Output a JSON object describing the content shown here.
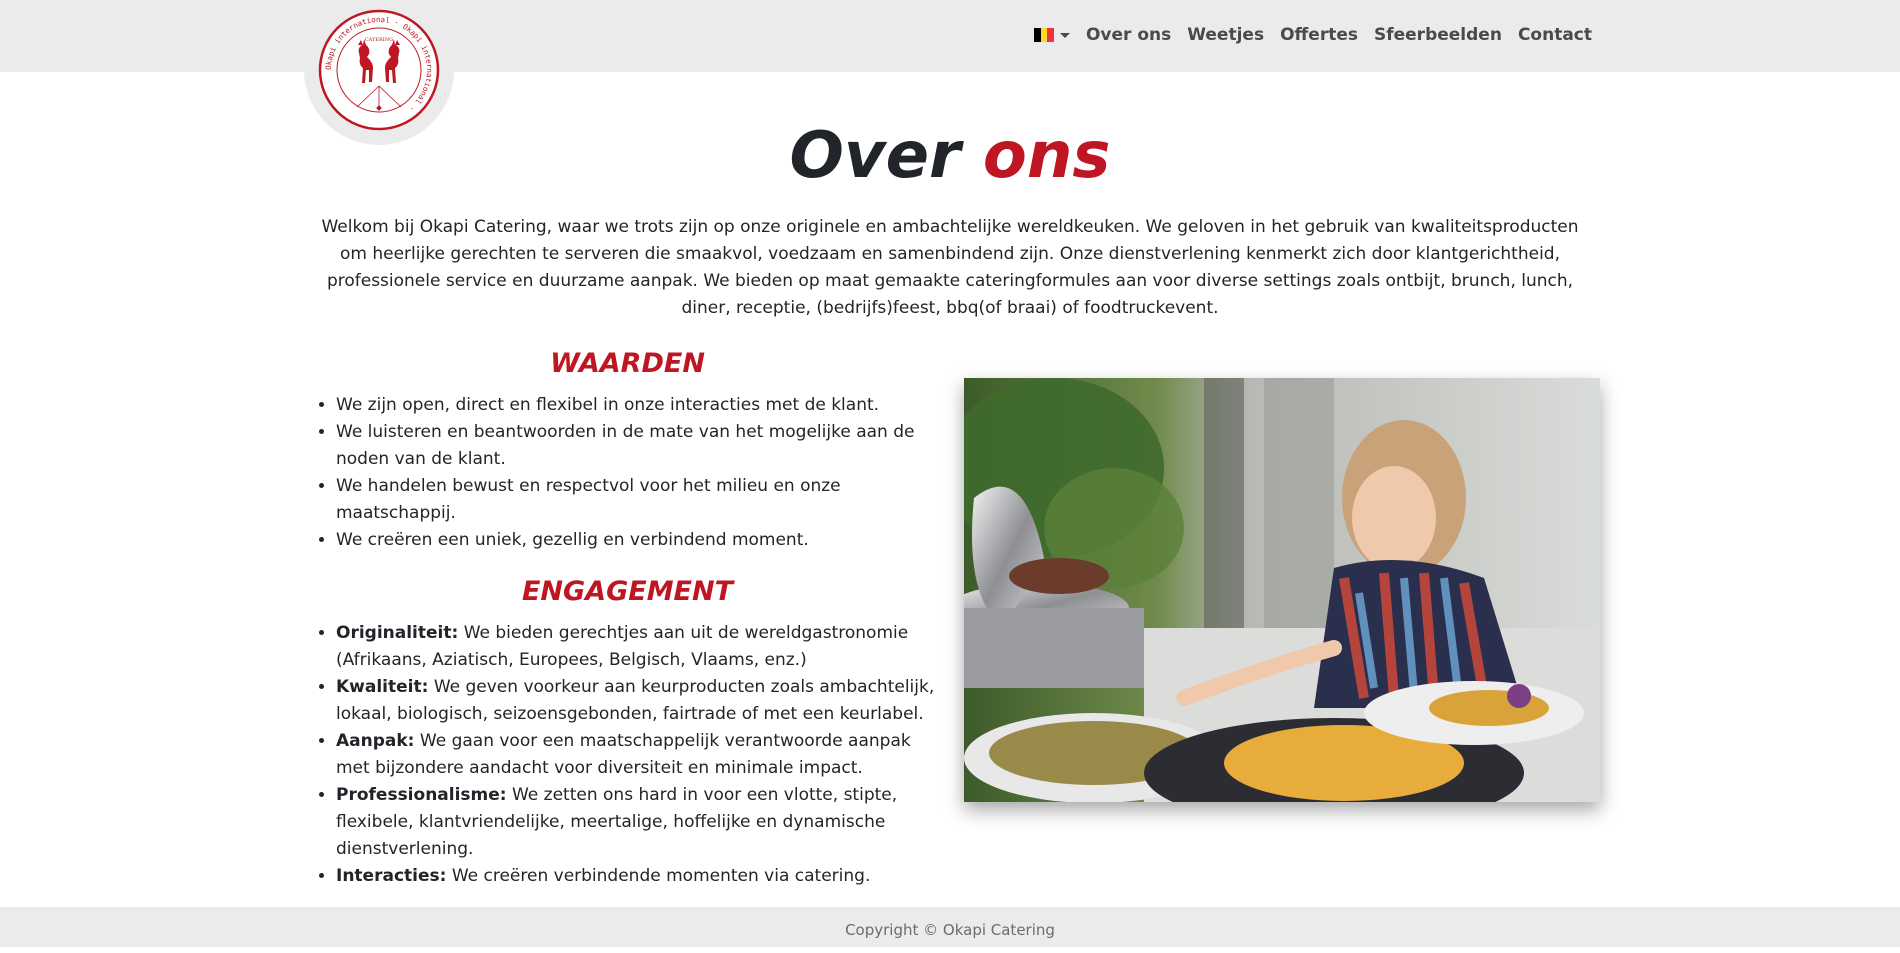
{
  "nav": {
    "language": "Nederlands (BE)",
    "flag_colors": [
      "#000000",
      "#fdda24",
      "#ef3340"
    ],
    "links": [
      "Over ons",
      "Weetjes",
      "Offertes",
      "Sfeerbeelden",
      "Contact"
    ]
  },
  "logo": {
    "ring_text": "Okapi international · Okapi international · ",
    "center_text": "CATERING",
    "color": "#be1622"
  },
  "page": {
    "title_part1": "Over",
    "title_part2": "ons",
    "intro": "Welkom bij Okapi Catering, waar we trots zijn op onze originele en ambachtelijke wereldkeuken. We geloven in het gebruik van kwaliteitsproducten om heerlijke gerechten te serveren die smaakvol, voedzaam en samenbindend zijn. Onze dienstverlening kenmerkt zich door klantgerichtheid, professionele service en duurzame aanpak. We bieden op maat gemaakte cateringformules aan voor diverse settings zoals ontbijt, brunch, lunch, diner, receptie, (bedrijfs)feest, bbq(of braai) of foodtruckevent."
  },
  "waarden": {
    "title": "WAARDEN",
    "items": [
      "We zijn open, direct en flexibel in onze interacties met de klant.",
      "We luisteren en beantwoorden in de mate van het mogelijke aan de noden van de klant.",
      "We handelen bewust en respectvol voor het milieu en onze maatschappij.",
      "We creëren een uniek, gezellig en verbindend moment."
    ]
  },
  "engagement": {
    "title": "ENGAGEMENT",
    "items": [
      {
        "term": "Originaliteit:",
        "text": " We bieden gerechtjes aan uit de wereldgastronomie (Afrikaans, Aziatisch, Europees, Belgisch, Vlaams, enz.)"
      },
      {
        "term": "Kwaliteit:",
        "text": " We geven voorkeur aan keurproducten zoals ambachtelijk, lokaal, biologisch, seizoensgebonden, fairtrade of met een keurlabel."
      },
      {
        "term": "Aanpak:",
        "text": " We gaan voor een maatschappelijk verantwoorde aanpak met bijzondere aandacht voor diversiteit en minimale impact."
      },
      {
        "term": "Professionalisme:",
        "text": " We zetten ons hard in voor een vlotte, stipte, flexibele, klantvriendelijke, meertalige, hoffelijke en dynamische dienstverlening."
      },
      {
        "term": "Interacties:",
        "text": " We creëren verbindende momenten via catering."
      }
    ]
  },
  "footer": {
    "copyright": "Copyright © Okapi Catering"
  },
  "colors": {
    "accent": "#be1622",
    "bar_bg": "#ebebeb"
  }
}
